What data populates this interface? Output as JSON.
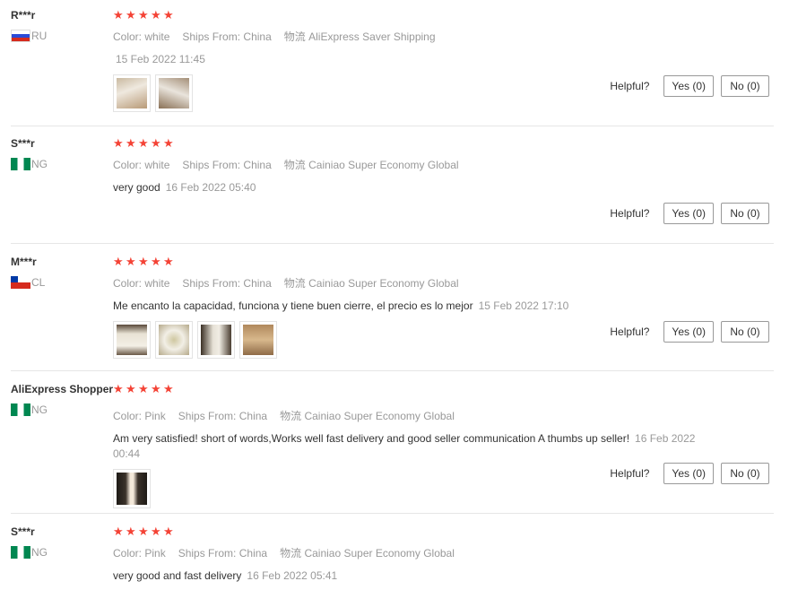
{
  "labels": {
    "color": "Color:",
    "ships_from": "Ships From:",
    "logistics": "物流",
    "helpful": "Helpful?",
    "yes": "Yes (0)",
    "no": "No (0)"
  },
  "colors": {
    "star": "#f44336",
    "muted": "#999999",
    "text": "#333333"
  },
  "reviews": [
    {
      "user": "R***r",
      "country": "RU",
      "rating": 5,
      "color": "white",
      "ships_from": "China",
      "logistics": "AliExpress Saver Shipping",
      "text": "",
      "date": "15 Feb 2022 11:45",
      "photo_count": 2
    },
    {
      "user": "S***r",
      "country": "NG",
      "rating": 5,
      "color": "white",
      "ships_from": "China",
      "logistics": "Cainiao Super Economy Global",
      "text": "very good",
      "date": "16 Feb 2022 05:40",
      "photo_count": 0
    },
    {
      "user": "M***r",
      "country": "CL",
      "rating": 5,
      "color": "white",
      "ships_from": "China",
      "logistics": "Cainiao Super Economy Global",
      "text": "Me encanto la capacidad, funciona y tiene buen cierre, el precio es lo mejor",
      "date": "15 Feb 2022 17:10",
      "photo_count": 4
    },
    {
      "user": "AliExpress Shopper",
      "country": "NG",
      "rating": 5,
      "color": "Pink",
      "ships_from": "China",
      "logistics": "Cainiao Super Economy Global",
      "text": "Am very satisfied! short of words,Works well fast delivery and good seller communication A thumbs up seller!",
      "date": "16 Feb 2022 00:44",
      "photo_count": 1
    },
    {
      "user": "S***r",
      "country": "NG",
      "rating": 5,
      "color": "Pink",
      "ships_from": "China",
      "logistics": "Cainiao Super Economy Global",
      "text": "very good and fast delivery",
      "date": "16 Feb 2022 05:41",
      "photo_count": 0
    }
  ]
}
